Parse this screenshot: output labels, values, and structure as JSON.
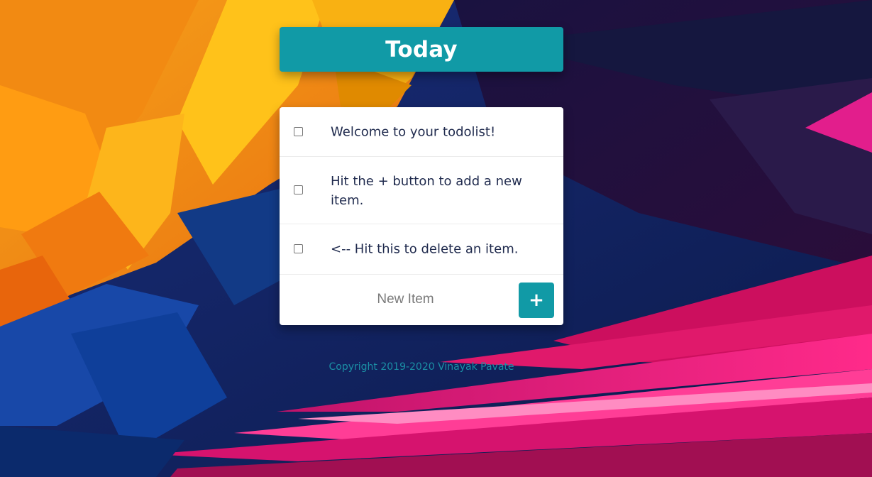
{
  "header": {
    "title": "Today"
  },
  "items": [
    {
      "text": "Welcome to your todolist!",
      "checked": false
    },
    {
      "text": "Hit the + button to add a new item.",
      "checked": false
    },
    {
      "text": "<-- Hit this to delete an item.",
      "checked": false
    }
  ],
  "new_item": {
    "placeholder": "New Item",
    "value": "",
    "add_label": "+"
  },
  "footer": {
    "copyright": "Copyright 2019-2020 Vinayak Pavate"
  },
  "colors": {
    "accent": "#119aa6",
    "text": "#1f2a4d",
    "footer": "#1b8fa5"
  }
}
